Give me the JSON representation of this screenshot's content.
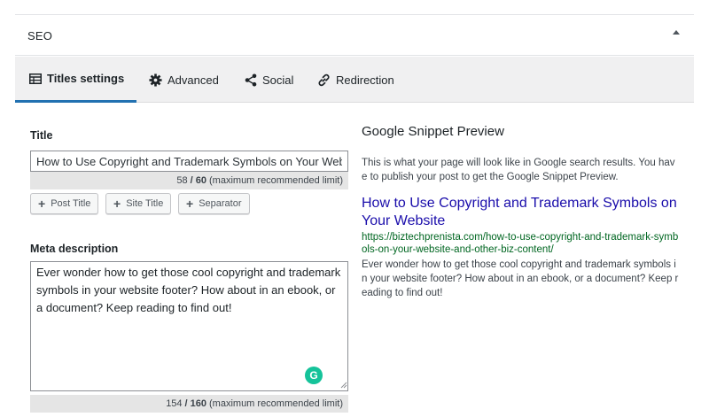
{
  "panel": {
    "title": "SEO",
    "collapse_icon": "triangle-up-icon"
  },
  "tabs": [
    {
      "label": "Titles settings",
      "icon": "table-icon",
      "active": true
    },
    {
      "label": "Advanced",
      "icon": "gear-icon",
      "active": false
    },
    {
      "label": "Social",
      "icon": "share-icon",
      "active": false
    },
    {
      "label": "Redirection",
      "icon": "link-icon",
      "active": false
    }
  ],
  "title_field": {
    "label": "Title",
    "value": "How to Use Copyright and Trademark Symbols on Your Website",
    "count": "58",
    "limit": "/ 60",
    "limit_note": "(maximum recommended limit)"
  },
  "tag_buttons": [
    {
      "label": "Post Title"
    },
    {
      "label": "Site Title"
    },
    {
      "label": "Separator"
    }
  ],
  "meta_description": {
    "label": "Meta description",
    "value": "Ever wonder how to get those cool copyright and trademark symbols in your website footer? How about in an ebook, or a document? Keep reading to find out!",
    "count": "154",
    "limit": "/ 160",
    "limit_note": "(maximum recommended limit)"
  },
  "preview": {
    "heading": "Google Snippet Preview",
    "note": "This is what your page will look like in Google search results. You have to publish your post to get the Google Snippet Preview.",
    "snippet_title": "How to Use Copyright and Trademark Symbols on Your Website",
    "snippet_url": "https://biztechprenista.com/how-to-use-copyright-and-trademark-symbols-on-your-website-and-other-biz-content/",
    "snippet_desc": "Ever wonder how to get those cool copyright and trademark symbols in your website footer? How about in an ebook, or a document? Keep reading to find out!"
  },
  "colors": {
    "link_title": "#1a0dab",
    "link_url": "#006621",
    "active_tab": "#2271b1",
    "grammarly": "#15c39a"
  }
}
